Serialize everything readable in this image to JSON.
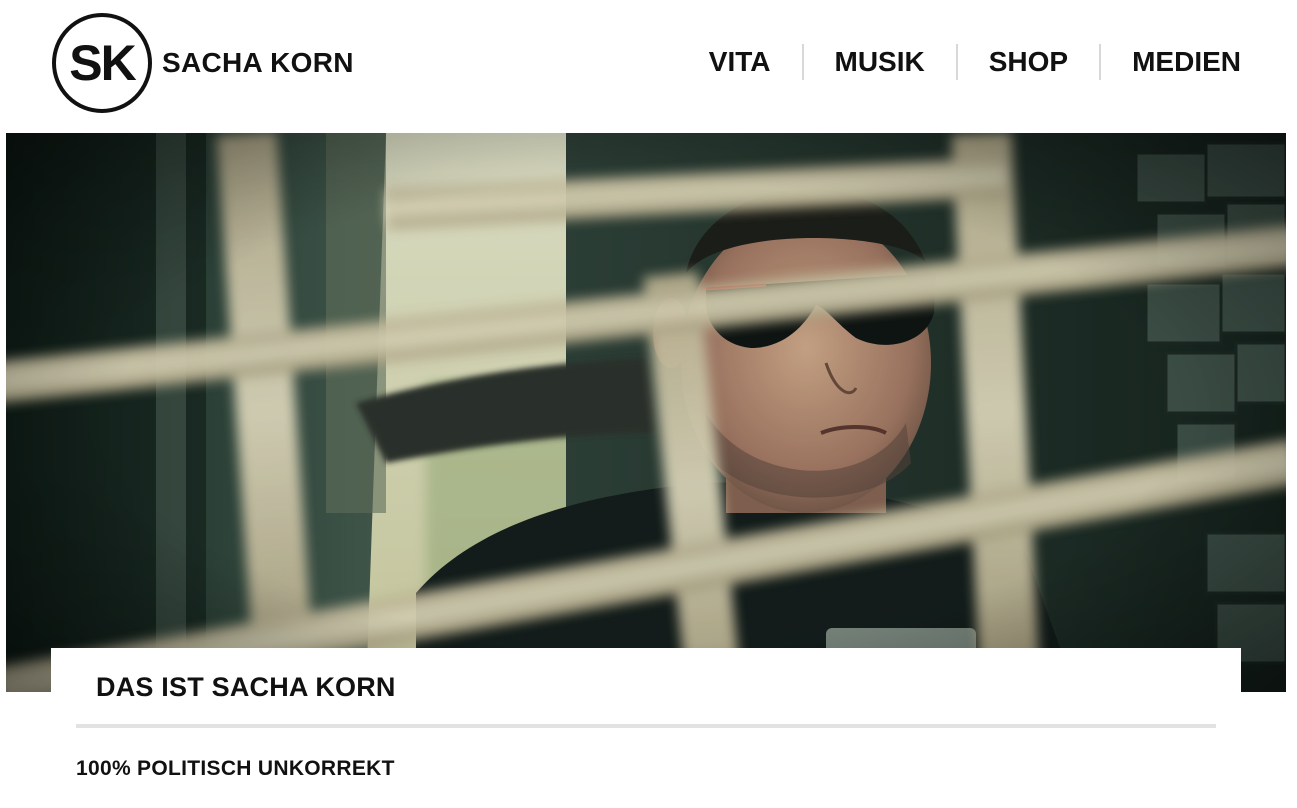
{
  "brand": {
    "monogram": "SK",
    "name": "SACHA KORN"
  },
  "nav": {
    "items": [
      {
        "label": "VITA"
      },
      {
        "label": "MUSIK"
      },
      {
        "label": "SHOP"
      },
      {
        "label": "MEDIEN"
      }
    ]
  },
  "hero": {
    "icon": "photo-man-sunglasses-behind-bars"
  },
  "intro": {
    "title": "DAS IST SACHA KORN",
    "subtitle": "100% POLITISCH UNKORREKT"
  },
  "colors": {
    "text": "#111111",
    "divider": "#e2e2e2",
    "nav_separator": "#d8d8d8",
    "background": "#ffffff"
  }
}
